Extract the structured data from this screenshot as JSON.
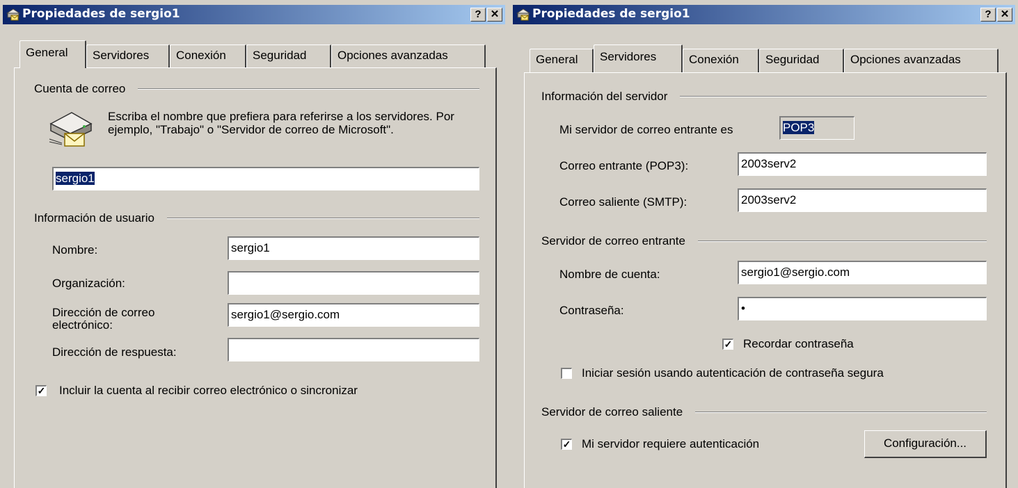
{
  "left_window": {
    "title": "Propiedades de sergio1",
    "help_button": "?",
    "close_button": "✕",
    "tabs": [
      "General",
      "Servidores",
      "Conexión",
      "Seguridad",
      "Opciones avanzadas"
    ],
    "active_tab": "General",
    "mail_account": {
      "group_label": "Cuenta de correo",
      "description": "Escriba el nombre que prefiera para referirse a los servidores. Por ejemplo, \"Trabajo\" o \"Servidor de correo de Microsoft\".",
      "account_name": "sergio1"
    },
    "user_info": {
      "group_label": "Información de usuario",
      "name_label": "Nombre:",
      "name_value": "sergio1",
      "organization_label": "Organización:",
      "organization_value": "",
      "email_label_line1": "Dirección de correo",
      "email_label_line2": "electrónico:",
      "email_value": "sergio1@sergio.com",
      "reply_label": "Dirección de respuesta:",
      "reply_value": ""
    },
    "include_checkbox_label": "Incluir la cuenta al recibir correo electrónico o sincronizar",
    "include_checked": true
  },
  "right_window": {
    "title": "Propiedades de sergio1",
    "help_button": "?",
    "close_button": "✕",
    "tabs": [
      "General",
      "Servidores",
      "Conexión",
      "Seguridad",
      "Opciones avanzadas"
    ],
    "active_tab": "Servidores",
    "server_info": {
      "group_label": "Información del servidor",
      "incoming_type_label": "Mi servidor de correo entrante es",
      "incoming_type_value": "POP3",
      "incoming_label": "Correo entrante (POP3):",
      "incoming_value": "2003serv2",
      "outgoing_label": "Correo saliente (SMTP):",
      "outgoing_value": "2003serv2"
    },
    "incoming_server": {
      "group_label": "Servidor de correo entrante",
      "account_label": "Nombre de cuenta:",
      "account_value": "sergio1@sergio.com",
      "password_label": "Contraseña:",
      "password_value": "•",
      "remember_label": "Recordar contraseña",
      "remember_checked": true,
      "spa_label": "Iniciar sesión usando autenticación de contraseña segura",
      "spa_checked": false
    },
    "outgoing_server": {
      "group_label": "Servidor de correo saliente",
      "auth_label": "Mi servidor requiere autenticación",
      "auth_checked": true,
      "settings_button": "Configuración..."
    }
  }
}
